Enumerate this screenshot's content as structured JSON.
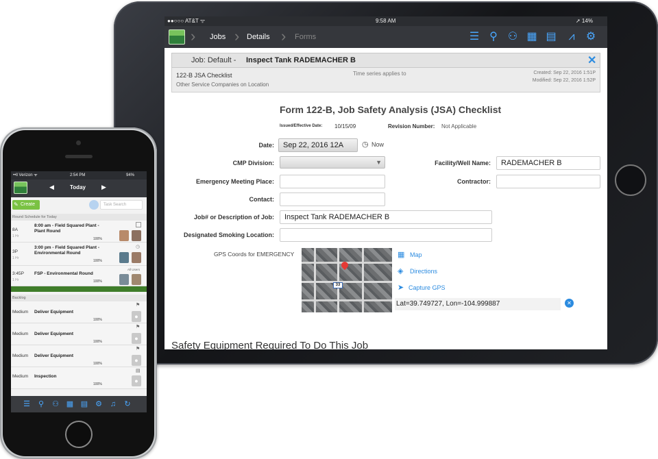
{
  "ipad": {
    "status": {
      "carrier": "●●○○○ AT&T ᯤ",
      "time": "9:58 AM",
      "battery": "➚ 14%"
    },
    "nav": {
      "crumbs": [
        "Jobs",
        "Details",
        "Forms"
      ],
      "icons": [
        "list-icon",
        "map-pin-icon",
        "users-icon",
        "map-icon",
        "calendar-icon",
        "chart-icon",
        "gear-icon"
      ]
    },
    "job": {
      "prefix": "Job: Default - ",
      "name": "Inspect Tank RADEMACHER B",
      "checklist": "122-B JSA Checklist",
      "time_series": "Time series applies to",
      "other": "Other Service Companies on Location",
      "created": "Created: Sep 22, 2016 1:51P",
      "modified": "Modified: Sep 22, 2016 1:52P"
    },
    "form": {
      "title": "Form 122-B, Job Safety Analysis (JSA) Checklist",
      "issued_label": "Issued/Effective Date:",
      "issued_value": "10/15/09",
      "revision_label": "Revision Number:",
      "revision_value": "Not Applicable",
      "date_label": "Date:",
      "date_value": "Sep 22, 2016 12A",
      "now_label": "Now",
      "cmp_label": "CMP Division:",
      "cmp_value": "",
      "facility_label": "Facility/Well Name:",
      "facility_value": "RADEMACHER B",
      "emergency_label": "Emergency Meeting Place:",
      "emergency_value": "",
      "contractor_label": "Contractor:",
      "contractor_value": "",
      "contact_label": "Contact:",
      "contact_value": "",
      "jobdesc_label": "Job# or Description of Job:",
      "jobdesc_value": "Inspect Tank RADEMACHER B",
      "smoking_label": "Designated Smoking Location:",
      "smoking_value": "",
      "gps_label": "GPS Coords for EMERGENCY",
      "map_link": "Map",
      "directions_link": "Directions",
      "capture_link": "Capture GPS",
      "coords": "Lat=39.749727, Lon=-104.999887",
      "section_heading": "Safety Equipment Required To Do This Job"
    }
  },
  "iphone": {
    "status": {
      "carrier": "••ll Verizon ᯤ",
      "time": "2:54 PM",
      "battery": "94%"
    },
    "nav_title": "Today",
    "create": "Create",
    "search_placeholder": "Task Search",
    "schedule_heading": "Round Schedule for Today",
    "rounds": [
      {
        "time": "8A",
        "dur": "1 Hr",
        "title": "8:00 am - Field Squared Plant - Plant Round",
        "pct": "100%"
      },
      {
        "time": "3P",
        "dur": "1 Hr",
        "title": "3:00 pm - Field Squared Plant - Environmental Round",
        "pct": "100%"
      },
      {
        "time": "3:45P",
        "dur": "1 Hr",
        "title": "FSP - Environmental Round",
        "pct": "100%",
        "tag": "All Users"
      }
    ],
    "backlog_heading": "Backlog",
    "backlog": [
      {
        "priority": "Medium",
        "title": "Deliver Equipment",
        "pct": "100%"
      },
      {
        "priority": "Medium",
        "title": "Deliver Equipment",
        "pct": "100%"
      },
      {
        "priority": "Medium",
        "title": "Deliver Equipment",
        "pct": "100%"
      },
      {
        "priority": "Medium",
        "title": "Inspection",
        "pct": "100%"
      }
    ],
    "tab_icons": [
      "list-icon",
      "map-pin-icon",
      "users-icon",
      "map-icon",
      "calendar-icon",
      "gear-icon",
      "bell-icon",
      "sync-icon"
    ]
  },
  "colors": {
    "accent": "#2b8be0",
    "nav_bg": "#35373c",
    "green": "#7ac243"
  }
}
